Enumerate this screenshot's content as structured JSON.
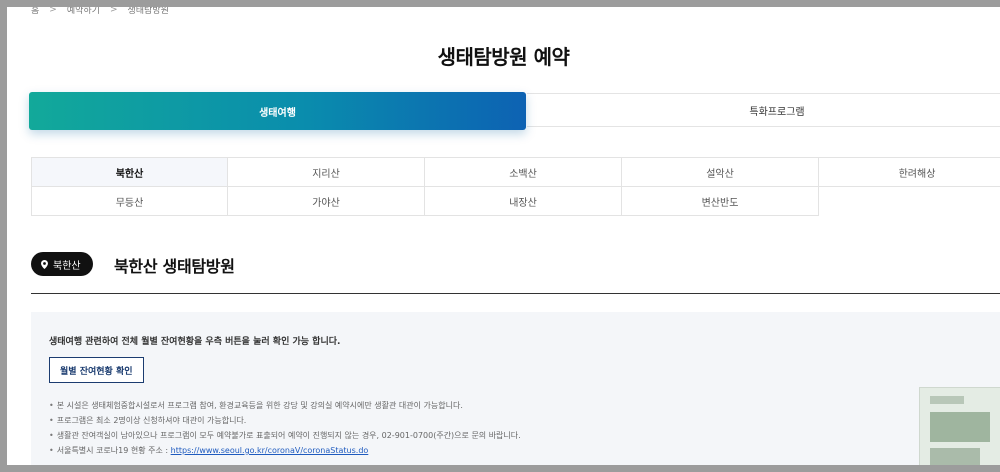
{
  "breadcrumb": [
    "홈",
    "예약하기",
    "생태탐방원"
  ],
  "page_title": "생태탐방원 예약",
  "main_tabs": [
    {
      "label": "생태여행",
      "active": true
    },
    {
      "label": "특화프로그램",
      "active": false
    }
  ],
  "mountains": [
    [
      "북한산",
      "지리산",
      "소백산",
      "설악산",
      "한려해상"
    ],
    [
      "무등산",
      "가야산",
      "내장산",
      "변산반도"
    ]
  ],
  "active_mountain": "북한산",
  "section": {
    "badge": "북한산",
    "title": "북한산 생태탐방원"
  },
  "info": {
    "description": "생태여행 관련하여 전체 월별 잔여현황을 우측 버튼을 눌러 확인 가능 합니다.",
    "button_label": "월별 잔여현황 확인",
    "notes": [
      "본 시설은 생태체험중합시설로서 프로그램 참여, 환경교육등을 위한 강당 및 강의실 예약시에만 생활관 대관이 가능합니다.",
      "프로그램은 최소 2명이상 신청하셔야 대관이 가능합니다.",
      "생활관 잔여객실이 남아있으나 프로그램이 모두 예약불가로 표출되어 예약이 진행되지 않는 경우, 02-901-0700(주간)으로 문의 바랍니다."
    ],
    "corona_prefix": "서울특별시 코로나19 현황 주소 : ",
    "corona_link": "https://www.seoul.go.kr/coronaV/coronaStatus.do"
  },
  "colors": {
    "accent_gradient_start": "#12a99a",
    "accent_gradient_end": "#0d62b3",
    "button_border": "#1b3c70",
    "link": "#1f5bbf"
  }
}
